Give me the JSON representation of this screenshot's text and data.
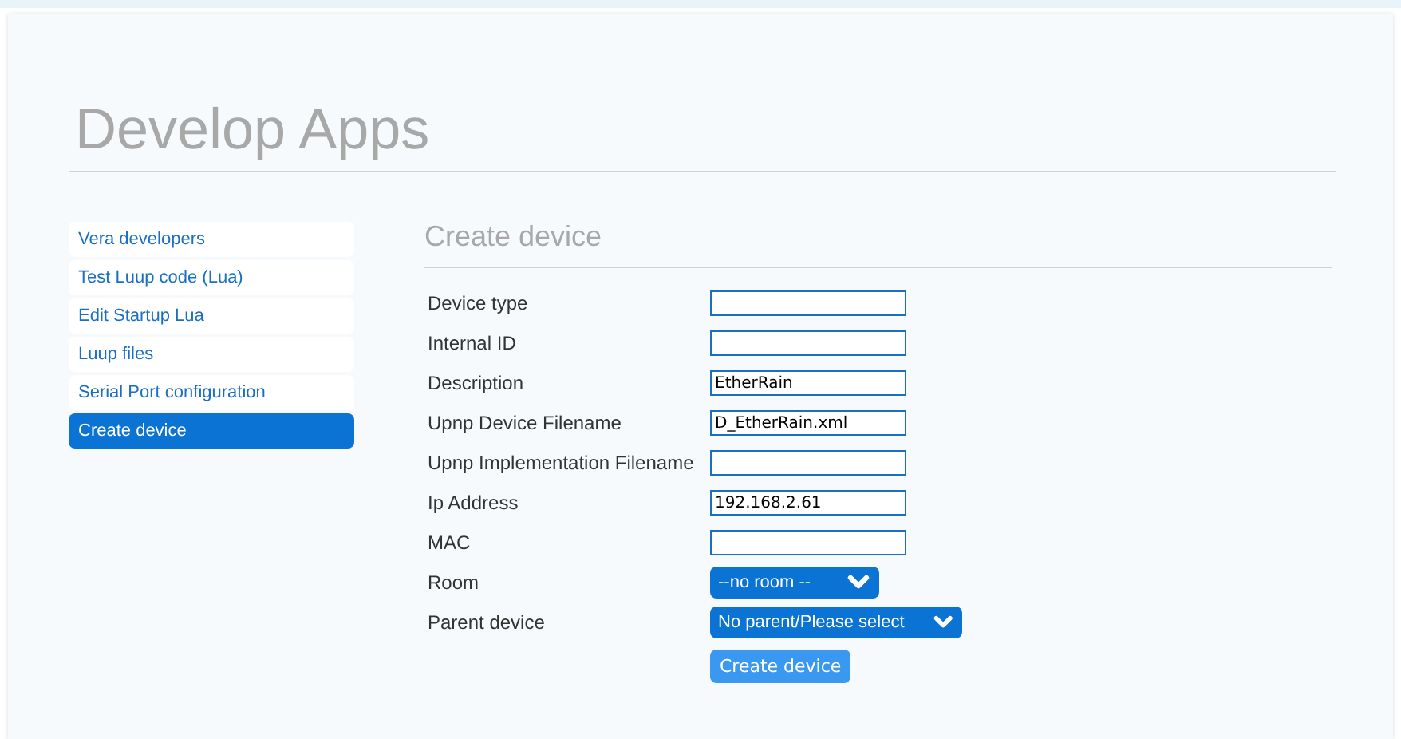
{
  "page": {
    "title": "Develop Apps"
  },
  "sidebar": {
    "items": [
      {
        "label": "Vera developers",
        "selected": false
      },
      {
        "label": "Test Luup code (Lua)",
        "selected": false
      },
      {
        "label": "Edit Startup Lua",
        "selected": false
      },
      {
        "label": "Luup files",
        "selected": false
      },
      {
        "label": "Serial Port configuration",
        "selected": false
      },
      {
        "label": "Create device",
        "selected": true
      }
    ]
  },
  "form": {
    "title": "Create device",
    "fields": [
      {
        "label": "Device type",
        "kind": "text"
      },
      {
        "label": "Internal ID",
        "kind": "text"
      },
      {
        "label": "Description",
        "kind": "text",
        "value": "EtherRain"
      },
      {
        "label": "Upnp Device Filename",
        "kind": "text",
        "value": "D_EtherRain.xml"
      },
      {
        "label": "Upnp Implementation Filename",
        "kind": "text"
      },
      {
        "label": "Ip Address",
        "kind": "text",
        "value": "192.168.2.61"
      },
      {
        "label": "MAC",
        "kind": "text"
      },
      {
        "label": "Room",
        "kind": "select",
        "value": "--no room --"
      },
      {
        "label": "Parent device",
        "kind": "select",
        "value": "No parent/Please select"
      }
    ],
    "submit": "Create device"
  }
}
